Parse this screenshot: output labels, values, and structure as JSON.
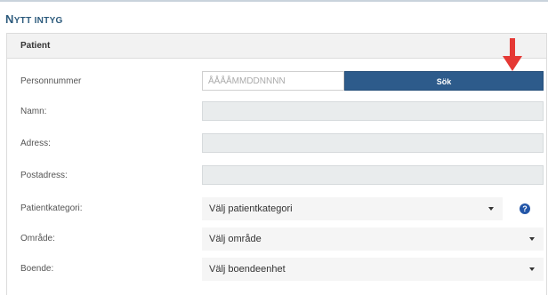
{
  "page": {
    "title_first": "N",
    "title_rest": "YTT INTYG"
  },
  "panel": {
    "header": "Patient"
  },
  "form": {
    "personnummer": {
      "label": "Personnummer",
      "placeholder": "ÅÅÅÅMMDDNNNN",
      "button_label": "Sök"
    },
    "namn": {
      "label": "Namn:"
    },
    "adress": {
      "label": "Adress:"
    },
    "postadress": {
      "label": "Postadress:"
    },
    "patientkategori": {
      "label": "Patientkategori:",
      "selected": "Välj patientkategori"
    },
    "omrade": {
      "label": "Område:",
      "selected": "Välj område"
    },
    "boende": {
      "label": "Boende:",
      "selected": "Välj boendeenhet"
    }
  },
  "icons": {
    "help": "question-circle-icon",
    "arrow": "red-down-arrow-icon",
    "caret": "chevron-down-icon"
  },
  "colors": {
    "title": "#2c5a7c",
    "search_button": "#2d5b8b",
    "help_icon": "#2356a8",
    "arrow": "#e53935"
  }
}
